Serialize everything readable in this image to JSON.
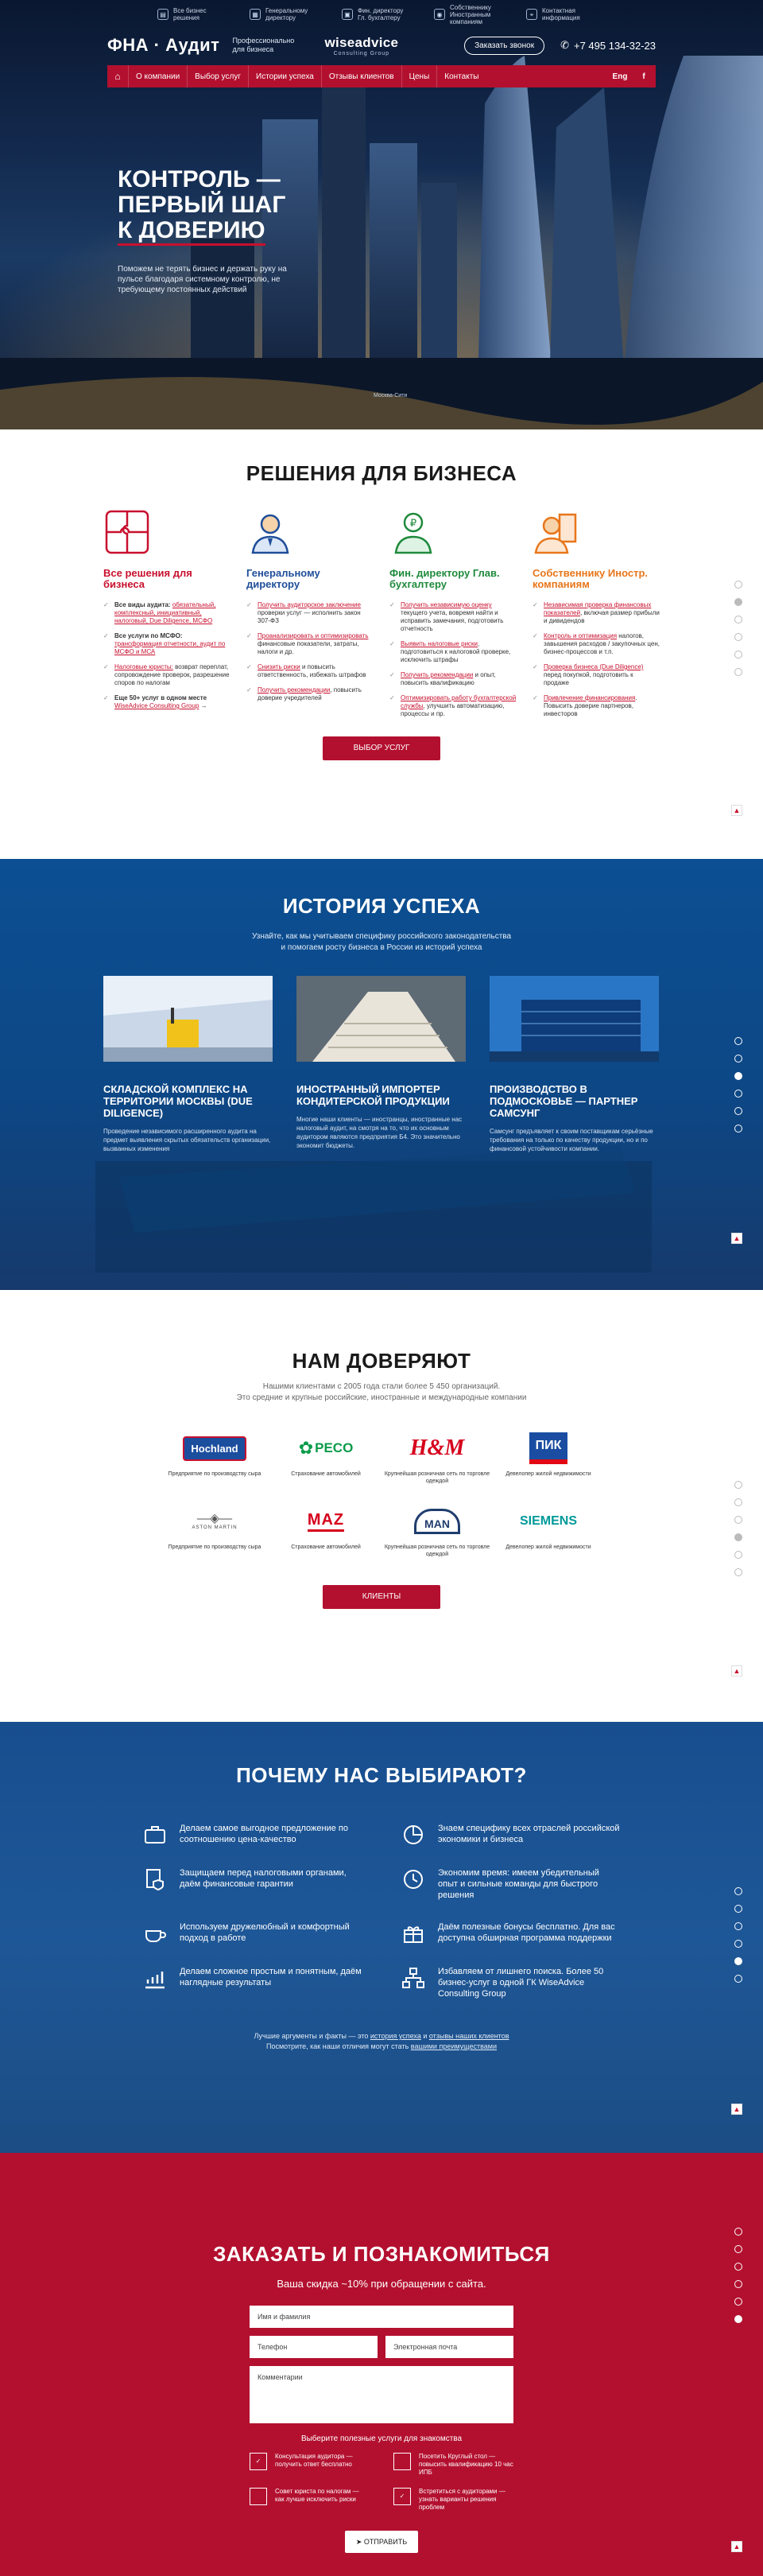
{
  "topbar": [
    {
      "icon": "document-icon",
      "text": "Все бизнес\nрешения"
    },
    {
      "icon": "briefcase-icon",
      "text": "Генеральному\nдиректору"
    },
    {
      "icon": "calculator-icon",
      "text": "Фин. директору\nГл. бухгалтеру"
    },
    {
      "icon": "owner-icon",
      "text": "Собственнику\nИностранным компаниям"
    },
    {
      "icon": "location-icon",
      "text": "Контактная\nинформация"
    }
  ],
  "header": {
    "logo": "ФНА · Аудит",
    "tagline": "Профессионально для бизнеса",
    "partner_name": "wiseadvice",
    "partner_sub": "Consulting Group",
    "call_button": "Заказать звонок",
    "phone": "+7 495 134-32-23"
  },
  "nav": {
    "items": [
      "О компании",
      "Выбор услуг",
      "Истории успеха",
      "Отзывы клиентов",
      "Цены",
      "Контакты"
    ],
    "lang": "Eng",
    "social": "f"
  },
  "hero": {
    "title_1": "КОНТРОЛЬ —",
    "title_2": "ПЕРВЫЙ ШАГ",
    "title_3": "К ДОВЕРИЮ",
    "text": "Поможем не терять бизнес и держать руку на пульсе благодаря системному контролю, не требующему постоянных действий",
    "caption": "Москва-Сити"
  },
  "solutions": {
    "title": "РЕШЕНИЯ ДЛЯ БИЗНЕСА",
    "cards": [
      {
        "icon": "puzzle-icon",
        "color": "#c8102e",
        "title": "Все решения для бизнеса",
        "items": [
          {
            "pre": "Все виды аудита: ",
            "hl": "обязательный, комплексный, инициативный, налоговый, Due Diligence, МСФО",
            "post": ""
          },
          {
            "pre": "Все услуги по МСФО: ",
            "hl": "трансформация отчетности, аудит по МСФО и МСА",
            "post": ""
          },
          {
            "pre": "",
            "hl": "Налоговые юристы:",
            "post": " возврат переплат, сопровождение проверок, разрешение споров по налогам"
          },
          {
            "pre": "Еще 50+ услуг в одном месте ",
            "hl": "WiseAdvice Consulting Group",
            "post": " →"
          }
        ]
      },
      {
        "icon": "director-icon",
        "color": "#1f4e9a",
        "title": "Генеральному директору",
        "items": [
          {
            "pre": "",
            "hl": "Получить аудиторское заключение",
            "post": " проверки услуг — исполнить закон 307-ФЗ"
          },
          {
            "pre": "",
            "hl": "Проанализировать и оптимизировать",
            "post": " финансовые показатели, затраты, налоги и др."
          },
          {
            "pre": "",
            "hl": "Снизить риски",
            "post": " и повысить ответственность, избежать штрафов"
          },
          {
            "pre": "",
            "hl": "Получить рекомендации",
            "post": ", повысить доверие учредителей"
          }
        ]
      },
      {
        "icon": "ruble-icon",
        "color": "#1f8a3c",
        "title": "Фин. директору Глав. бухгалтеру",
        "items": [
          {
            "pre": "",
            "hl": "Получить независимую оценку",
            "post": " текущего учета, вовремя найти и исправить замечания, подготовить отчетность"
          },
          {
            "pre": "",
            "hl": "Выявить налоговые риски",
            "post": ", подготовиться к налоговой проверке, исключить штрафы"
          },
          {
            "pre": "",
            "hl": "Получить рекомендации",
            "post": " и опыт, повысить квалификацию"
          },
          {
            "pre": "",
            "hl": "Оптимизировать работу бухгалтерской службы",
            "post": ", улучшить автоматизацию, процессы и пр."
          }
        ]
      },
      {
        "icon": "owner-icon",
        "color": "#e8761a",
        "title": "Собственнику Иностр. компаниям",
        "items": [
          {
            "pre": "",
            "hl": "Независимая проверка финансовых показателей",
            "post": ", включая размер прибыли и дивидендов"
          },
          {
            "pre": "",
            "hl": "Контроль и оптимизация",
            "post": " налогов, завышения расходов / закупочных цен, бизнес-процессов и т.п."
          },
          {
            "pre": "",
            "hl": "Проверка бизнеса (Due Diligence)",
            "post": " перед покупкой, подготовить к продаже"
          },
          {
            "pre": "",
            "hl": "Привлечение финансирования",
            "post": ". Повысить доверие партнеров, инвесторов"
          }
        ]
      }
    ],
    "button": "ВЫБОР УСЛУГ"
  },
  "success": {
    "title": "ИСТОРИЯ УСПЕХА",
    "sub_1": "Узнайте, как мы учитываем специфику российского законодательства",
    "sub_2": "и помогаем росту бизнеса в России из историй успеха",
    "cases": [
      {
        "title": "СКЛАДСКОЙ КОМПЛЕКС НА ТЕРРИТОРИИ МОСКВЫ (DUE DILIGENCE)",
        "text": "Проведение независимого расширенного аудита на предмет выявления скрытых обязательств организации, вызванных изменения"
      },
      {
        "title": "ИНОСТРАННЫЙ ИМПОРТЕР КОНДИТЕРСКОЙ ПРОДУКЦИИ",
        "text": "Многие наши клиенты — иностранцы, иностранные нас налоговый аудит, на смотря на то, что их основным аудитором являются предприятия Б4. Это значительно экономит бюджеты."
      },
      {
        "title": "ПРОИЗВОДСТВО В ПОДМОСКОВЬЕ — ПАРТНЕР САМСУНГ",
        "text": "Самсунг предъявляет к своим поставщикам серьёзные требования на только по качеству продукции, но и по финансовой устойчивости компании."
      }
    ]
  },
  "trust": {
    "title": "НАМ ДОВЕРЯЮТ",
    "sub_1": "Нашими клиентами с 2005 года стали более 5 450 организаций.",
    "sub_2": "Это средние и крупные российские, иностранные и международные компании",
    "logos": [
      {
        "name": "Hochland",
        "cap": "Предприятие по производству сыра"
      },
      {
        "name": "PECO",
        "cap": "Страхование автомобилей"
      },
      {
        "name": "H&M",
        "cap": "Крупнейшая розничная сеть по торговле одеждой"
      },
      {
        "name": "ПИК",
        "cap": "Девелопер жилой недвижимости"
      },
      {
        "name": "ASTON MARTIN",
        "cap": "Предприятие по производству сыра"
      },
      {
        "name": "MAZ",
        "cap": "Страхование автомобилей"
      },
      {
        "name": "MAN",
        "cap": "Крупнейшая розничная сеть по торговле одеждой"
      },
      {
        "name": "SIEMENS",
        "cap": "Девелопер жилой недвижимости"
      }
    ],
    "button": "КЛИЕНТЫ"
  },
  "why": {
    "title": "ПОЧЕМУ НАС ВЫБИРАЮТ?",
    "items": [
      {
        "icon": "briefcase-icon",
        "text": "Делаем самое выгодное предложение по соотношению цена-качество"
      },
      {
        "icon": "pie-chart-icon",
        "text": "Знаем специфику всех отраслей российской экономики и бизнеса"
      },
      {
        "icon": "document-shield-icon",
        "text": "Защищаем перед налоговыми органами, даём финансовые гарантии"
      },
      {
        "icon": "clock-icon",
        "text": "Экономим время: имеем убедительный опыт и сильные команды для быстрого решения"
      },
      {
        "icon": "cup-icon",
        "text": "Используем дружелюбный и комфортный подход в работе"
      },
      {
        "icon": "gift-icon",
        "text": "Даём полезные бонусы бесплатно. Для вас доступна обширная программа поддержки"
      },
      {
        "icon": "growth-chart-icon",
        "text": "Делаем сложное простым и понятным, даём наглядные результаты"
      },
      {
        "icon": "structure-icon",
        "text": "Избавляем от лишнего поиска. Более 50 бизнес-услуг в одной ГК WiseAdvice Consulting Group"
      }
    ],
    "foot_pre": "Лучшие аргументы и факты — это ",
    "foot_l1": "история успеха",
    "foot_mid": " и ",
    "foot_l2": "отзывы наших клиентов",
    "foot_2_pre": "Посмотрите, как наши отличия могут стать ",
    "foot_2_l": "вашими преимуществами"
  },
  "order": {
    "title": "ЗАКАЗАТЬ И ПОЗНАКОМИТЬСЯ",
    "discount": "Ваша скидка ~10% при обращении с сайта.",
    "name_ph": "Имя и фамилия",
    "phone_ph": "Телефон",
    "email_ph": "Электронная почта",
    "comment_ph": "Комментарии",
    "options_title": "Выберите полезные услуги для знакомства",
    "options": [
      {
        "checked": true,
        "text": "Консультация аудитора — получить ответ бесплатно"
      },
      {
        "checked": false,
        "text": "Посетить Круглый стол — повысить квалификацию 10 час ИПБ"
      },
      {
        "checked": false,
        "text": "Совет юриста по налогам — как лучше исключить риски"
      },
      {
        "checked": true,
        "text": "Встретиться с аудиторами — узнать варианты решения проблем"
      }
    ],
    "submit": "ОТПРАВИТЬ"
  },
  "colors": {
    "brand_red": "#b3102f",
    "brand_blue": "#0d4785"
  }
}
